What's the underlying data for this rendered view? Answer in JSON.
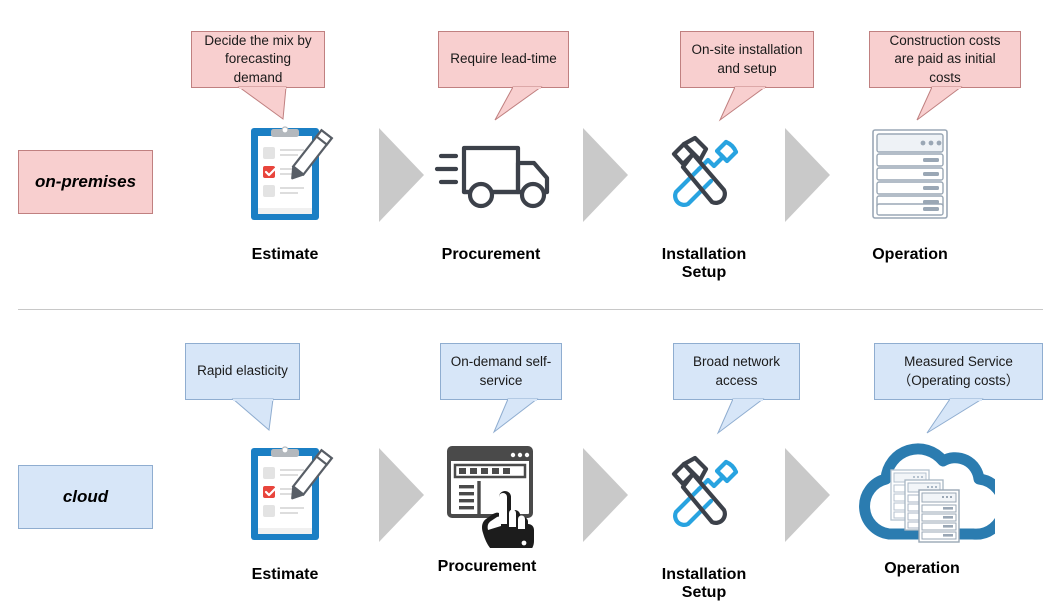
{
  "theme": {
    "onprem_fill": "#f8cfcf",
    "onprem_stroke": "#c08080",
    "cloud_fill": "#d7e6f8",
    "cloud_stroke": "#8fadd0",
    "arrow_gray": "#c9c9c9",
    "divider": "#c8c8c8",
    "icon_blue": "#1b7fc4",
    "icon_dark": "#3c414a",
    "icon_cyan": "#28a3e0",
    "icon_red": "#e8453c",
    "cloud_blue": "#2b7cb0",
    "rack_gray": "#9aa7b5"
  },
  "rows": [
    {
      "id": "on-premises",
      "label": "on-premises",
      "style": "onprem",
      "steps": [
        {
          "id": "estimate",
          "label": "Estimate",
          "icon": "clipboard-checklist-icon",
          "callout": "Decide the mix by forecasting demand"
        },
        {
          "id": "procurement",
          "label": "Procurement",
          "icon": "delivery-truck-icon",
          "callout": "Require lead-time"
        },
        {
          "id": "installation",
          "label": "Installation\nSetup",
          "icon": "hammer-wrench-icon",
          "callout": "On-site installation and setup"
        },
        {
          "id": "operation",
          "label": "Operation",
          "icon": "server-rack-icon",
          "callout": "Construction costs are paid as initial costs"
        }
      ]
    },
    {
      "id": "cloud",
      "label": "cloud",
      "style": "cloud",
      "steps": [
        {
          "id": "estimate",
          "label": "Estimate",
          "icon": "clipboard-checklist-icon",
          "callout": "Rapid elasticity"
        },
        {
          "id": "procurement",
          "label": "Procurement",
          "icon": "browser-click-icon",
          "callout": "On-demand self-service"
        },
        {
          "id": "installation",
          "label": "Installation\nSetup",
          "icon": "hammer-wrench-icon",
          "callout": "Broad network access"
        },
        {
          "id": "operation",
          "label": "Operation",
          "icon": "cloud-servers-icon",
          "callout": "Measured Service（Operating costs）"
        }
      ]
    }
  ],
  "arrows": {
    "glyph": "right-triangle-arrow",
    "count_per_row": 3
  }
}
